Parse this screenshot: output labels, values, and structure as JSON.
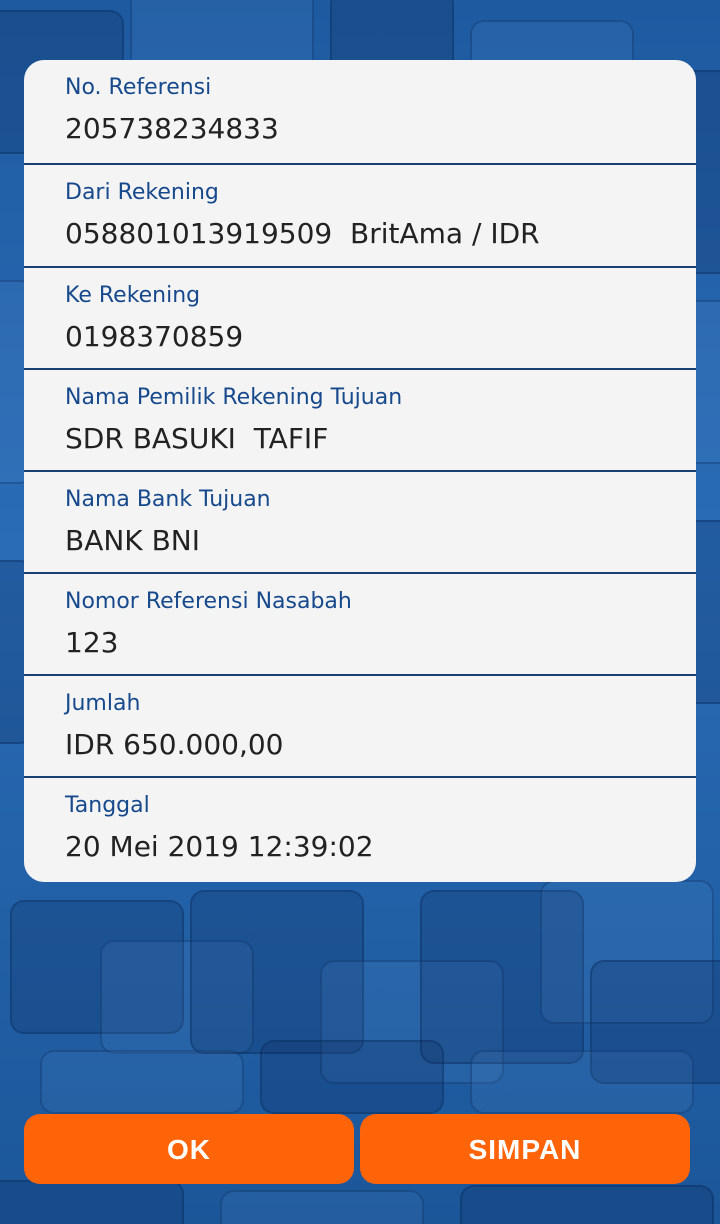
{
  "details": [
    {
      "label": "No. Referensi",
      "value": "205738234833"
    },
    {
      "label": "Dari Rekening",
      "value": "058801013919509  BritAma / IDR"
    },
    {
      "label": "Ke Rekening",
      "value": "0198370859"
    },
    {
      "label": "Nama Pemilik Rekening Tujuan",
      "value": "SDR BASUKI  TAFIF"
    },
    {
      "label": "Nama Bank Tujuan",
      "value": "BANK BNI"
    },
    {
      "label": "Nomor Referensi Nasabah",
      "value": "123"
    },
    {
      "label": "Jumlah",
      "value": "IDR 650.000,00"
    },
    {
      "label": "Tanggal",
      "value": "20 Mei 2019 12:39:02"
    }
  ],
  "buttons": {
    "ok_label": "OK",
    "save_label": "SIMPAN"
  },
  "colors": {
    "accent": "#ff6409",
    "label": "#17498d",
    "card": "#f4f4f4",
    "background": "#1f5fa8"
  }
}
